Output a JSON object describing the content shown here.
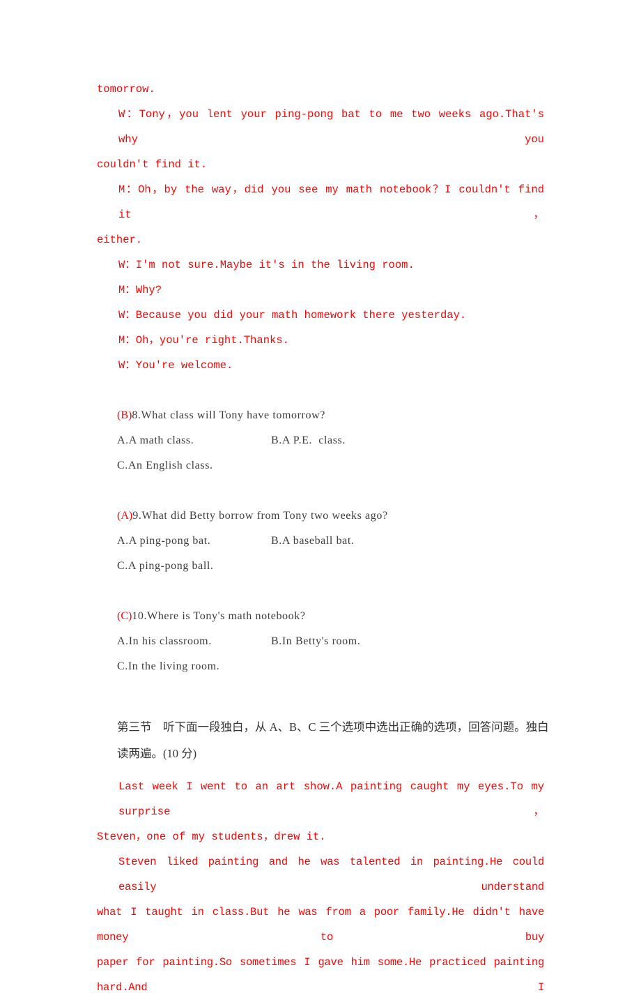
{
  "document": {
    "type": "english-listening-exam-answer-key",
    "page_background": "#ffffff",
    "script_text_color": "#fd0404",
    "question_text_color": "#3c3c3c",
    "answer_marker_color": "#fd0404"
  },
  "dialogue_script": {
    "continuation_line": "tomorrow.",
    "lines": [
      {
        "speaker_text": "W：Tony，you lent your ping-pong bat to me two weeks ago.That's why you",
        "wrap_text": "couldn't find it."
      },
      {
        "speaker_text": "M：Oh，by the way，did you see my math notebook？I couldn't find it，",
        "wrap_text": "either."
      }
    ],
    "short_lines": [
      "W：I'm not sure.Maybe it's in the living room.",
      "M：Why?",
      "W：Because you did your math homework there yesterday.",
      "M：Oh，you're right.Thanks.",
      "W：You're welcome."
    ]
  },
  "questions": [
    {
      "answer": "(B)",
      "stem": "8.What class will Tony have tomorrow?",
      "option_a": "A.A math class.",
      "option_b": "B.A P.E.  class.",
      "option_c": "C.An English class."
    },
    {
      "answer": "(A)",
      "stem": "9.What did Betty borrow from Tony two weeks ago?",
      "option_a": "A.A ping-pong bat.",
      "option_b": "B.A baseball bat.",
      "option_c": "C.A ping-pong ball."
    },
    {
      "answer": "(C)",
      "stem": "10.Where is Tony's math notebook?",
      "option_a": "A.In his classroom.",
      "option_b": "B.In Betty's room.",
      "option_c": "C.In the living room."
    }
  ],
  "section_instruction": {
    "line1": "第三节　听下面一段独白，从 A、B、C 三个选项中选出正确的选项，回答问题。独白",
    "line2": "读两遍。(10 分)"
  },
  "monologue": {
    "para1_line1": "Last week I went to an art show.A painting caught my eyes.To my surprise，",
    "para1_line2": "Steven，one of my students，drew it.",
    "para2_line1": "Steven liked painting and he was talented in painting.He could easily understand",
    "para2_line2": "what I taught in class.But he was from a poor family.He didn't have money to buy",
    "para2_line3": "paper for painting.So sometimes I gave him some.He practiced painting hard.And I"
  }
}
